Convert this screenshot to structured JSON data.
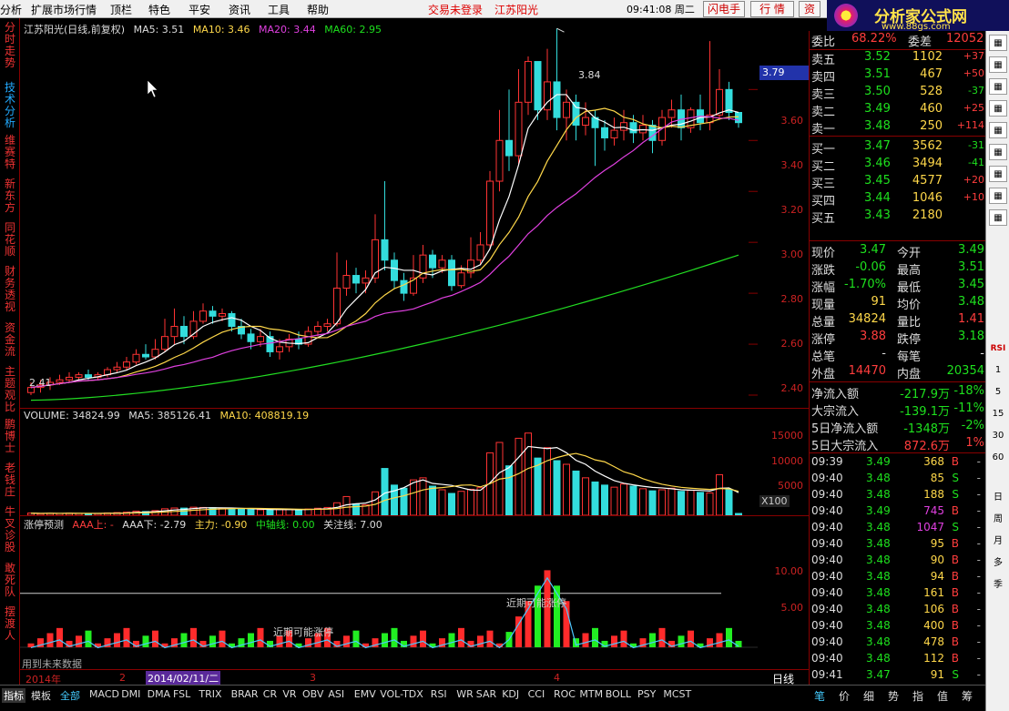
{
  "menubar": {
    "items": [
      "分析",
      "扩展市场行情",
      "顶栏",
      "特色",
      "平安",
      "资讯",
      "工具",
      "帮助"
    ],
    "login_status": "交易未登录",
    "title": "江苏阳光",
    "clock": "09:41:08 周二",
    "buttons": [
      "闪电手",
      "行 情",
      "资"
    ]
  },
  "logo": {
    "name": "分析家公式网",
    "url": "www.88gs.com"
  },
  "left_tabs": [
    "分时走势",
    "技术分析",
    "维赛特",
    "新东方",
    "同花顺",
    "财务透视",
    "资金流",
    "主题观比",
    "鹏博士",
    "老钱庄",
    "牛叉诊股",
    "敢死队",
    "摆渡人"
  ],
  "price_panel": {
    "legend": {
      "name": "江苏阳光(日线,前复权)",
      "ma5": "MA5: 3.51",
      "ma10": "MA10: 3.46",
      "ma20": "MA20: 3.44",
      "ma60": "MA60: 2.95"
    },
    "high_label": "3.84",
    "low_label": "2.41",
    "current_price_tag": "3.79",
    "y_ticks": [
      "3.60",
      "3.40",
      "3.20",
      "3.00",
      "2.80",
      "2.60",
      "2.40"
    ]
  },
  "volume_panel": {
    "legend": {
      "vol": "VOLUME: 34824.99",
      "ma5": "MA5: 385126.41",
      "ma10": "MA10: 408819.19"
    },
    "y_ticks": [
      "15000",
      "10000",
      "5000"
    ],
    "unit": "X100"
  },
  "indicator_panel": {
    "legend": {
      "name": "涨停预测",
      "aaa_up": "AAA上: -",
      "aaa_down": "AAA下: -2.79",
      "main": "主力: -0.90",
      "mid": "中轴线: 0.00",
      "focus": "关注线: 7.00"
    },
    "y_ticks": [
      "10.00",
      "5.00"
    ],
    "annotations": [
      "近期可能涨停",
      "近期可能涨停"
    ],
    "footnote": "用到未来数据"
  },
  "xaxis": {
    "labels": [
      "2014年",
      "2",
      "3",
      "4"
    ],
    "selected_date": "2014/02/11/二",
    "period": "日线"
  },
  "bottom_tabs": [
    "指标",
    "模板",
    "全部",
    "MACD",
    "DMI",
    "DMA",
    "FSL",
    "TRIX",
    "BRAR",
    "CR",
    "VR",
    "OBV",
    "ASI",
    "EMV",
    "VOL-TDX",
    "RSI",
    "WR",
    "SAR",
    "KDJ",
    "CCI",
    "ROC",
    "MTM",
    "BOLL",
    "PSY",
    "MCST"
  ],
  "quote": {
    "header": {
      "label1": "委比",
      "value1": "68.22%",
      "label2": "委差",
      "value2": "12052"
    },
    "asks": [
      {
        "label": "卖五",
        "price": "3.52",
        "vol": "1102",
        "chg": "+37"
      },
      {
        "label": "卖四",
        "price": "3.51",
        "vol": "467",
        "chg": "+50"
      },
      {
        "label": "卖三",
        "price": "3.50",
        "vol": "528",
        "chg": "-37"
      },
      {
        "label": "卖二",
        "price": "3.49",
        "vol": "460",
        "chg": "+25"
      },
      {
        "label": "卖一",
        "price": "3.48",
        "vol": "250",
        "chg": "+114"
      }
    ],
    "bids": [
      {
        "label": "买一",
        "price": "3.47",
        "vol": "3562",
        "chg": "-31"
      },
      {
        "label": "买二",
        "price": "3.46",
        "vol": "3494",
        "chg": "-41"
      },
      {
        "label": "买三",
        "price": "3.45",
        "vol": "4577",
        "chg": "+20"
      },
      {
        "label": "买四",
        "price": "3.44",
        "vol": "1046",
        "chg": "+10"
      },
      {
        "label": "买五",
        "price": "3.43",
        "vol": "2180",
        "chg": ""
      }
    ],
    "stats": [
      {
        "l1": "现价",
        "v1": "3.47",
        "c1": "green",
        "l2": "今开",
        "v2": "3.49",
        "c2": "green"
      },
      {
        "l1": "涨跌",
        "v1": "-0.06",
        "c1": "green",
        "l2": "最高",
        "v2": "3.51",
        "c2": "green"
      },
      {
        "l1": "涨幅",
        "v1": "-1.70%",
        "c1": "green",
        "l2": "最低",
        "v2": "3.45",
        "c2": "green"
      },
      {
        "l1": "现量",
        "v1": "91",
        "c1": "yellow",
        "l2": "均价",
        "v2": "3.48",
        "c2": "green"
      },
      {
        "l1": "总量",
        "v1": "34824",
        "c1": "yellow",
        "l2": "量比",
        "v2": "1.41",
        "c2": "red"
      },
      {
        "l1": "涨停",
        "v1": "3.88",
        "c1": "red",
        "l2": "跌停",
        "v2": "3.18",
        "c2": "green"
      },
      {
        "l1": "总笔",
        "v1": "-",
        "c1": "white",
        "l2": "每笔",
        "v2": "-",
        "c2": "white"
      },
      {
        "l1": "外盘",
        "v1": "14470",
        "c1": "red",
        "l2": "内盘",
        "v2": "20354",
        "c2": "green"
      }
    ],
    "flows": [
      {
        "label": "净流入额",
        "value": "-217.9万",
        "pct": "-18%",
        "c": "green"
      },
      {
        "label": "大宗流入",
        "value": "-139.1万",
        "pct": "-11%",
        "c": "green"
      },
      {
        "label": "5日净流入额",
        "value": "-1348万",
        "pct": "-2%",
        "c": "green"
      },
      {
        "label": "5日大宗流入",
        "value": "872.6万",
        "pct": "1%",
        "c": "red"
      }
    ],
    "ticks": [
      {
        "t": "09:39",
        "p": "3.49",
        "v": "368",
        "d": "B",
        "vc": "yellow"
      },
      {
        "t": "09:40",
        "p": "3.48",
        "v": "85",
        "d": "S",
        "vc": "yellow"
      },
      {
        "t": "09:40",
        "p": "3.48",
        "v": "188",
        "d": "S",
        "vc": "yellow"
      },
      {
        "t": "09:40",
        "p": "3.49",
        "v": "745",
        "d": "B",
        "vc": "magenta"
      },
      {
        "t": "09:40",
        "p": "3.48",
        "v": "1047",
        "d": "S",
        "vc": "magenta"
      },
      {
        "t": "09:40",
        "p": "3.48",
        "v": "95",
        "d": "B",
        "vc": "yellow"
      },
      {
        "t": "09:40",
        "p": "3.48",
        "v": "90",
        "d": "B",
        "vc": "yellow"
      },
      {
        "t": "09:40",
        "p": "3.48",
        "v": "94",
        "d": "B",
        "vc": "yellow"
      },
      {
        "t": "09:40",
        "p": "3.48",
        "v": "161",
        "d": "B",
        "vc": "yellow"
      },
      {
        "t": "09:40",
        "p": "3.48",
        "v": "106",
        "d": "B",
        "vc": "yellow"
      },
      {
        "t": "09:40",
        "p": "3.48",
        "v": "400",
        "d": "B",
        "vc": "yellow"
      },
      {
        "t": "09:40",
        "p": "3.48",
        "v": "478",
        "d": "B",
        "vc": "yellow"
      },
      {
        "t": "09:40",
        "p": "3.48",
        "v": "112",
        "d": "B",
        "vc": "yellow"
      },
      {
        "t": "09:41",
        "p": "3.47",
        "v": "91",
        "d": "S",
        "vc": "yellow"
      }
    ],
    "tabs": [
      "笔",
      "价",
      "细",
      "势",
      "指",
      "值",
      "筹"
    ]
  },
  "right_toolbar": [
    "RSI",
    "1",
    "5",
    "15",
    "30",
    "60",
    "日",
    "周",
    "月",
    "多",
    "季"
  ],
  "chart_data": {
    "type": "candlestick",
    "ylim": [
      2.35,
      3.88
    ],
    "candles": [
      [
        2.41,
        2.43,
        2.4,
        2.45
      ],
      [
        2.43,
        2.44,
        2.41,
        2.46
      ],
      [
        2.44,
        2.45,
        2.42,
        2.47
      ],
      [
        2.45,
        2.46,
        2.44,
        2.48
      ],
      [
        2.46,
        2.47,
        2.45,
        2.49
      ],
      [
        2.47,
        2.48,
        2.46,
        2.49
      ],
      [
        2.48,
        2.47,
        2.46,
        2.5
      ],
      [
        2.47,
        2.48,
        2.46,
        2.49
      ],
      [
        2.48,
        2.5,
        2.47,
        2.51
      ],
      [
        2.5,
        2.51,
        2.49,
        2.53
      ],
      [
        2.51,
        2.53,
        2.5,
        2.55
      ],
      [
        2.53,
        2.56,
        2.52,
        2.58
      ],
      [
        2.56,
        2.55,
        2.54,
        2.6
      ],
      [
        2.55,
        2.58,
        2.54,
        2.62
      ],
      [
        2.58,
        2.63,
        2.57,
        2.7
      ],
      [
        2.63,
        2.67,
        2.6,
        2.74
      ],
      [
        2.67,
        2.63,
        2.6,
        2.71
      ],
      [
        2.63,
        2.69,
        2.62,
        2.73
      ],
      [
        2.69,
        2.73,
        2.68,
        2.76
      ],
      [
        2.73,
        2.71,
        2.68,
        2.75
      ],
      [
        2.71,
        2.72,
        2.69,
        2.74
      ],
      [
        2.72,
        2.67,
        2.65,
        2.73
      ],
      [
        2.67,
        2.64,
        2.62,
        2.7
      ],
      [
        2.64,
        2.61,
        2.58,
        2.66
      ],
      [
        2.61,
        2.63,
        2.59,
        2.66
      ],
      [
        2.63,
        2.57,
        2.55,
        2.65
      ],
      [
        2.57,
        2.59,
        2.54,
        2.62
      ],
      [
        2.59,
        2.62,
        2.57,
        2.64
      ],
      [
        2.62,
        2.6,
        2.58,
        2.65
      ],
      [
        2.6,
        2.65,
        2.59,
        2.67
      ],
      [
        2.65,
        2.67,
        2.63,
        2.69
      ],
      [
        2.67,
        2.68,
        2.65,
        2.7
      ],
      [
        2.68,
        2.82,
        2.67,
        2.96
      ],
      [
        2.82,
        2.87,
        2.79,
        2.93
      ],
      [
        2.87,
        2.84,
        2.8,
        2.9
      ],
      [
        2.84,
        2.86,
        2.8,
        2.89
      ],
      [
        2.86,
        3.01,
        2.84,
        3.11
      ],
      [
        3.01,
        2.93,
        2.89,
        3.24
      ],
      [
        2.93,
        2.85,
        2.82,
        2.96
      ],
      [
        2.85,
        2.8,
        2.77,
        2.88
      ],
      [
        2.8,
        2.86,
        2.79,
        2.95
      ],
      [
        2.86,
        2.95,
        2.84,
        2.99
      ],
      [
        2.95,
        2.9,
        2.86,
        2.97
      ],
      [
        2.9,
        2.93,
        2.88,
        2.95
      ],
      [
        2.93,
        2.83,
        2.81,
        2.95
      ],
      [
        2.83,
        2.88,
        2.82,
        2.91
      ],
      [
        2.88,
        2.93,
        2.86,
        3.02
      ],
      [
        2.93,
        2.99,
        2.91,
        3.04
      ],
      [
        2.99,
        3.24,
        2.97,
        3.28
      ],
      [
        3.24,
        3.4,
        3.2,
        3.52
      ],
      [
        3.4,
        3.34,
        3.28,
        3.6
      ],
      [
        3.34,
        3.55,
        3.3,
        3.68
      ],
      [
        3.55,
        3.71,
        3.5,
        3.73
      ],
      [
        3.71,
        3.52,
        3.48,
        3.68
      ],
      [
        3.52,
        3.63,
        3.48,
        3.76
      ],
      [
        3.63,
        3.49,
        3.44,
        3.84
      ],
      [
        3.49,
        3.55,
        3.4,
        3.6
      ],
      [
        3.55,
        3.46,
        3.4,
        3.58
      ],
      [
        3.46,
        3.49,
        3.42,
        3.55
      ],
      [
        3.49,
        3.45,
        3.3,
        3.52
      ],
      [
        3.45,
        3.41,
        3.36,
        3.48
      ],
      [
        3.41,
        3.44,
        3.38,
        3.49
      ],
      [
        3.44,
        3.47,
        3.4,
        3.52
      ],
      [
        3.47,
        3.43,
        3.39,
        3.5
      ],
      [
        3.43,
        3.46,
        3.4,
        3.5
      ],
      [
        3.46,
        3.4,
        3.35,
        3.48
      ],
      [
        3.4,
        3.49,
        3.38,
        3.52
      ],
      [
        3.49,
        3.52,
        3.45,
        3.56
      ],
      [
        3.52,
        3.45,
        3.4,
        3.58
      ],
      [
        3.45,
        3.52,
        3.43,
        3.53
      ],
      [
        3.52,
        3.47,
        3.44,
        3.58
      ],
      [
        3.47,
        3.5,
        3.44,
        3.79
      ],
      [
        3.5,
        3.6,
        3.48,
        3.68
      ],
      [
        3.6,
        3.51,
        3.48,
        3.63
      ],
      [
        3.51,
        3.47,
        3.45,
        3.51
      ]
    ],
    "volumes": [
      420,
      300,
      380,
      350,
      410,
      360,
      320,
      340,
      450,
      520,
      610,
      800,
      720,
      900,
      1250,
      1400,
      1380,
      1550,
      1500,
      1450,
      1300,
      1250,
      1200,
      1100,
      1050,
      1000,
      1100,
      1150,
      1080,
      1200,
      1350,
      1500,
      2400,
      3600,
      2200,
      2000,
      4500,
      9000,
      5800,
      5200,
      6800,
      7200,
      5600,
      4900,
      4200,
      4600,
      5000,
      5300,
      12000,
      14000,
      9500,
      14800,
      15800,
      11000,
      13000,
      10500,
      9800,
      8500,
      7200,
      6400,
      5800,
      5400,
      6000,
      5600,
      5100,
      4700,
      4900,
      5200,
      4600,
      4800,
      4400,
      4300,
      7800,
      5000,
      349
    ]
  }
}
